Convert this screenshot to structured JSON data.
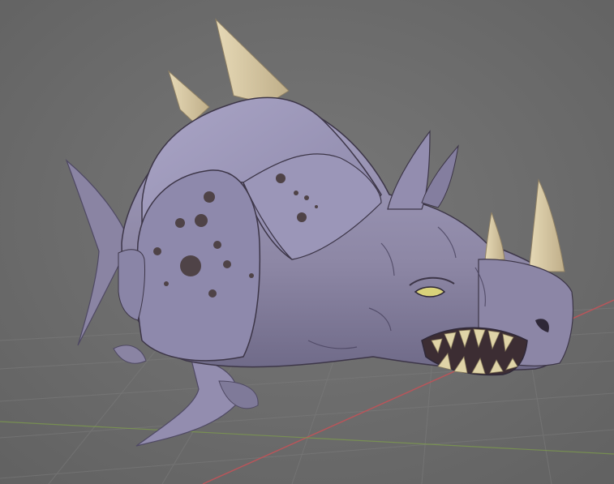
{
  "scene": {
    "subject": "rhino-fish-creature",
    "colors": {
      "background": "#6f6f6f",
      "grid_line": "#7a7a7a",
      "axis_x": "#b9555a",
      "axis_y": "#7fa04a",
      "body": "#8d87a5",
      "body_light": "#a49fc0",
      "body_shadow": "#6b6685",
      "armor": "#9a95b8",
      "armor_dark": "#6e6a86",
      "spots": "#4f4347",
      "horn": "#d8c9a6",
      "horn_shadow": "#b8a782",
      "teeth": "#e0d4a8",
      "mouth": "#3c2d33",
      "eye": "#d9d27a",
      "outline": "#3d3648"
    }
  }
}
